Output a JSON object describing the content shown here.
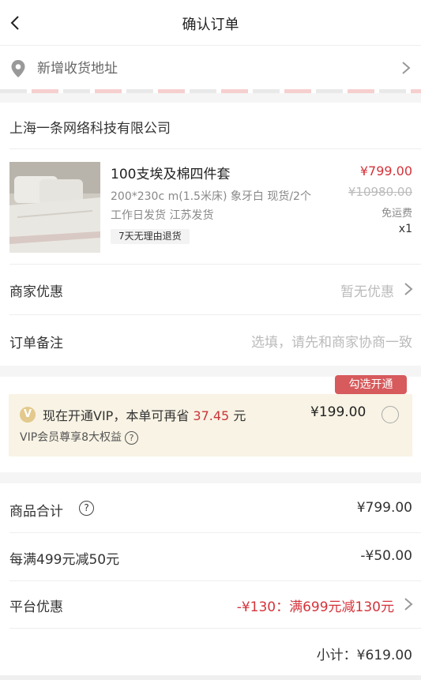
{
  "header": {
    "title": "确认订单",
    "back_icon": "chevron-left-icon"
  },
  "address": {
    "label": "新增收货地址",
    "icon": "location-pin-icon"
  },
  "store": {
    "name": "上海一条网络科技有限公司"
  },
  "product": {
    "name": "100支埃及棉四件套",
    "spec": "200*230c m(1.5米床)  象牙白  现货/2个",
    "shipping": "工作日发货  江苏发货",
    "badge": "7天无理由退货",
    "price": "¥799.00",
    "original_price": "¥10980.00",
    "shipping_fee": "免运费",
    "quantity": "x1"
  },
  "merchant_discount": {
    "label": "商家优惠",
    "value": "暂无优惠"
  },
  "order_note": {
    "label": "订单备注",
    "placeholder": "选填，请先和商家协商一致"
  },
  "vip": {
    "tag": "勾选开通",
    "badge": "V",
    "text_prefix": "现在开通VIP，本单可再省",
    "save_amount": "37.45",
    "text_suffix": "元",
    "subtitle": "VIP会员尊享8大权益",
    "help": "?",
    "price": "¥199.00"
  },
  "summary": {
    "goods_total_label": "商品合计",
    "goods_total_help": "?",
    "goods_total_value": "¥799.00",
    "promo_label": "每满499元减50元",
    "promo_value": "-¥50.00",
    "platform_label": "平台优惠",
    "platform_value": "-¥130：满699元减130元",
    "subtotal": "小计：¥619.00"
  },
  "colors": {
    "accent": "#d4333a",
    "vip_bg": "#f8f3e4",
    "vip_tag": "#d75a5c"
  }
}
